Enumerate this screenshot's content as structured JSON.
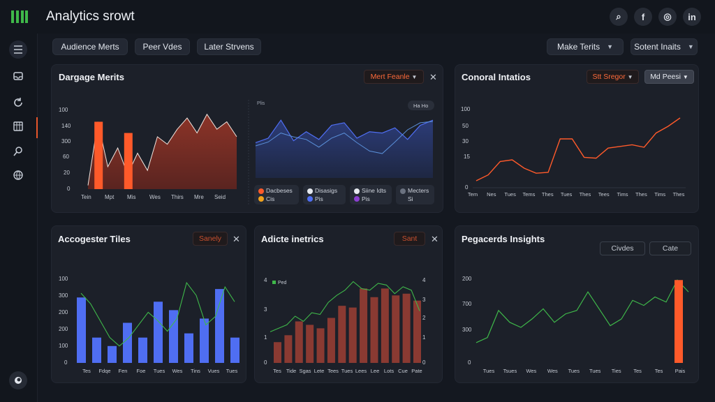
{
  "app": {
    "title": "Analytics srowt"
  },
  "header_icons": [
    "search-icon",
    "facebook-icon",
    "instagram-icon",
    "linkedin-icon"
  ],
  "header_glyphs": {
    "search": "⌕",
    "facebook": "f",
    "instagram": "◎",
    "linkedin": "in"
  },
  "sidebar": {
    "items": [
      "list-icon",
      "inbox-icon",
      "refresh-icon",
      "calendar-icon",
      "user-search-icon",
      "globe-icon",
      "help-icon"
    ]
  },
  "toolbar": {
    "tabs": [
      "Audience Merts",
      "Peer Vdes",
      "Later Strvens"
    ],
    "selects": [
      "Make Terits",
      "Sotent Inaits"
    ]
  },
  "colors": {
    "accent": "#ff5a2a",
    "blue": "#4f6ef2",
    "green": "#3fb84a",
    "bg": "#141820",
    "panel": "#1c2029"
  },
  "panels": {
    "engage": {
      "title": "Dargage Merits",
      "control": "Mert Feanle",
      "left_chart": {
        "y_ticks": [
          "100",
          "140",
          "300",
          "60",
          "20",
          "0"
        ],
        "x_ticks": [
          "Tein",
          "Mpt",
          "Mis",
          "Wes",
          "Thirs",
          "Mre",
          "Seid"
        ]
      },
      "right_chart": {
        "label": "Plis",
        "badge": "Ha Ho",
        "legend": [
          {
            "a": "Dacbeses",
            "b": "Cis"
          },
          {
            "a": "Disasigs",
            "b": "Pis"
          },
          {
            "a": "Siine Idts",
            "b": "Pis"
          },
          {
            "a": "Mecters",
            "b": "Si"
          }
        ]
      }
    },
    "general": {
      "title": "Conoral Intatios",
      "control_a": "Stt Sregor",
      "control_b": "Md Peesi",
      "y_ticks": [
        "100",
        "50",
        "30",
        "15",
        "0"
      ],
      "x_ticks": [
        "Tem",
        "Nes",
        "Tues",
        "Tems",
        "Thes",
        "Tues",
        "Thes",
        "Tees",
        "Tims",
        "Thes",
        "Tims",
        "Thes"
      ]
    },
    "accog": {
      "title": "Accogester Tiles",
      "control": "Sanely",
      "y_ticks": [
        "100",
        "300",
        "200",
        "200",
        "100",
        "0"
      ],
      "x_ticks": [
        "Tes",
        "Fdqe",
        "Fen",
        "Foe",
        "Tues",
        "Wes",
        "Tins",
        "Vues",
        "Tues"
      ]
    },
    "audience": {
      "title": "Adicte inetrics",
      "control": "Sant",
      "legend": "Ped",
      "y_ticks": [
        "4",
        "3",
        "1",
        "0"
      ],
      "y2_ticks": [
        "4",
        "3",
        "2",
        "1",
        "0"
      ],
      "x_ticks": [
        "Tes",
        "Tide",
        "Sgas",
        "Lete",
        "Tees",
        "Tues",
        "Lees",
        "Lee",
        "Lots",
        "Cue",
        "Pate"
      ]
    },
    "insights": {
      "title": "Pegacerds Insights",
      "btn_a": "Civdes",
      "btn_b": "Cate",
      "y_ticks": [
        "200",
        "700",
        "300",
        "0"
      ],
      "x_ticks": [
        "Tues",
        "Tsues",
        "Wes",
        "Wes",
        "Tues",
        "Tues",
        "Ties",
        "Tes",
        "Tes",
        "Pais"
      ]
    }
  },
  "chart_data": [
    {
      "type": "area",
      "series": [
        {
          "values": [
            5,
            90,
            30,
            55,
            20,
            48,
            25,
            70,
            60,
            80,
            95,
            75,
            100,
            80,
            90,
            70
          ]
        }
      ],
      "bars": [
        {
          "x": 1,
          "value": 90
        },
        {
          "x": 4,
          "value": 75
        }
      ],
      "ylim": [
        0,
        110
      ]
    },
    {
      "type": "line",
      "series": [
        {
          "values": [
            55,
            62,
            90,
            58,
            72,
            60,
            82,
            86,
            62,
            72,
            70,
            78,
            60,
            82,
            90
          ]
        },
        {
          "values": [
            50,
            56,
            70,
            64,
            60,
            48,
            62,
            70,
            55,
            42,
            38,
            56,
            75,
            86,
            88
          ]
        }
      ],
      "ylim": [
        0,
        100
      ]
    },
    {
      "type": "line",
      "series": [
        {
          "values": [
            5,
            12,
            28,
            30,
            20,
            14,
            15,
            55,
            55,
            33,
            32,
            44,
            46,
            48,
            45,
            62,
            70,
            80
          ]
        }
      ],
      "ylim": [
        0,
        100
      ]
    },
    {
      "type": "bar",
      "bars": [
        310,
        120,
        80,
        190,
        120,
        290,
        250,
        140,
        210,
        350,
        120
      ],
      "line": [
        330,
        280,
        200,
        120,
        80,
        120,
        180,
        240,
        200,
        150,
        210,
        380,
        320,
        180,
        220,
        360,
        290
      ],
      "ylim": [
        0,
        400
      ]
    },
    {
      "type": "bar",
      "bars": [
        1.2,
        1.6,
        2.4,
        2.2,
        2.0,
        2.6,
        3.3,
        3.2,
        4.3,
        3.8,
        4.3,
        3.9,
        4.0,
        3.6
      ],
      "line": [
        1.8,
        2.0,
        2.2,
        2.7,
        2.4,
        2.9,
        2.8,
        3.5,
        3.9,
        4.2,
        4.7,
        4.3,
        4.2,
        4.6,
        4.5,
        4.0,
        4.4,
        4.2,
        3.0
      ],
      "ylim": [
        0,
        5
      ]
    },
    {
      "type": "line",
      "series": [
        {
          "values": [
            120,
            150,
            310,
            240,
            210,
            260,
            320,
            240,
            290,
            310,
            420,
            320,
            220,
            260,
            370,
            340,
            390,
            360,
            490,
            420
          ]
        }
      ],
      "bars": [
        {
          "x": 19,
          "value": 490
        }
      ],
      "ylim": [
        0,
        520
      ]
    }
  ]
}
